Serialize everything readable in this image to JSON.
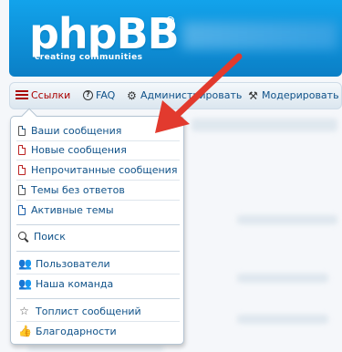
{
  "header": {
    "logo_text": "phpBB",
    "logo_registered": "®",
    "logo_tagline": "creating communities"
  },
  "navbar": {
    "links_label": "Ссылки",
    "faq_label": "FAQ",
    "admin_label": "Администрировать",
    "moderate_label": "Модерировать"
  },
  "dropdown": {
    "items": [
      {
        "label": "Ваши сообщения",
        "icon": "doc-icon"
      },
      {
        "label": "Новые сообщения",
        "icon": "doc-red-icon"
      },
      {
        "label": "Непрочитанные сообщения",
        "icon": "doc-red-icon"
      },
      {
        "label": "Темы без ответов",
        "icon": "doc-icon"
      },
      {
        "label": "Активные темы",
        "icon": "doc-blue-icon"
      },
      {
        "label": "Поиск",
        "icon": "search-icon"
      },
      {
        "label": "Пользователи",
        "icon": "users-icon"
      },
      {
        "label": "Наша команда",
        "icon": "team-icon"
      },
      {
        "label": "Топлист сообщений",
        "icon": "star-icon"
      },
      {
        "label": "Благодарности",
        "icon": "thumbs-up-icon"
      }
    ]
  },
  "colors": {
    "header_blue": "#0b7fc6",
    "link_blue": "#105289",
    "links_red": "#aa0000",
    "arrow_red": "#e23a2e"
  }
}
